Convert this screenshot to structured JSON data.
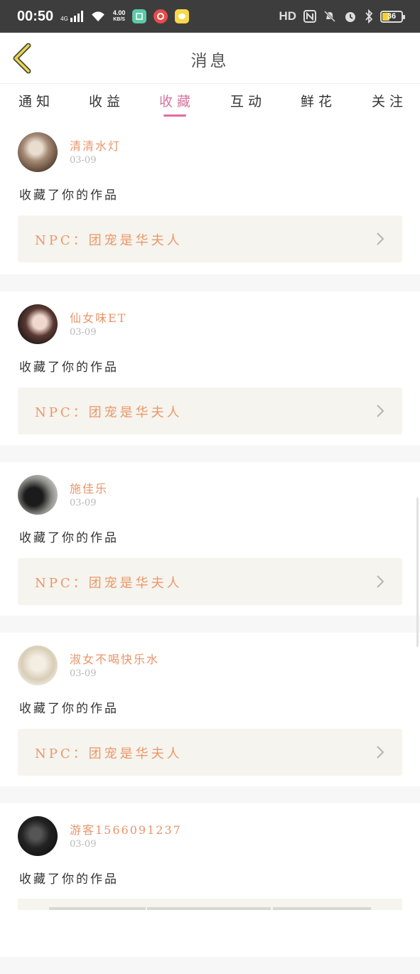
{
  "status_bar": {
    "time": "00:50",
    "network": "4G",
    "speed_value": "4.00",
    "speed_unit": "KB/S",
    "hd": "HD",
    "battery": "36"
  },
  "header": {
    "title": "消息"
  },
  "tabs": [
    {
      "label": "通知",
      "active": false
    },
    {
      "label": "收益",
      "active": false
    },
    {
      "label": "收藏",
      "active": true
    },
    {
      "label": "互动",
      "active": false
    },
    {
      "label": "鲜花",
      "active": false
    },
    {
      "label": "关注",
      "active": false
    }
  ],
  "items": [
    {
      "username": "清清水灯",
      "date": "03-09",
      "action": "收藏了你的作品",
      "work": "NPC：团宠是华夫人"
    },
    {
      "username": "仙女味ET",
      "date": "03-09",
      "action": "收藏了你的作品",
      "work": "NPC：团宠是华夫人"
    },
    {
      "username": "施佳乐",
      "date": "03-09",
      "action": "收藏了你的作品",
      "work": "NPC：团宠是华夫人"
    },
    {
      "username": "淑女不喝快乐水",
      "date": "03-09",
      "action": "收藏了你的作品",
      "work": "NPC：团宠是华夫人"
    },
    {
      "username": "游客1566091237",
      "date": "03-09",
      "action": "收藏了你的作品",
      "work": ""
    }
  ],
  "colors": {
    "accent_pink": "#e36aa0",
    "username_orange": "#e8956a",
    "work_bg": "#f5f4ee"
  }
}
